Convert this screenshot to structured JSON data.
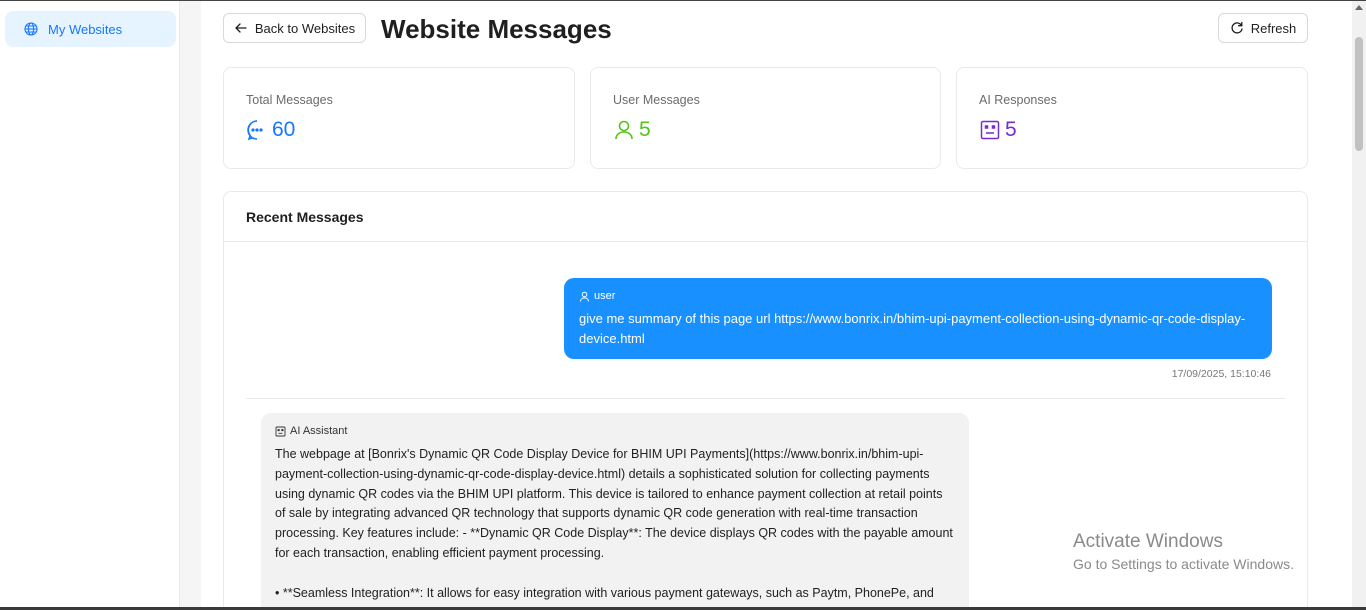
{
  "sidebar": {
    "items": [
      {
        "label": "My Websites",
        "icon": "globe-icon",
        "active": true
      }
    ]
  },
  "header": {
    "back_label": "Back to Websites",
    "title": "Website Messages",
    "refresh_label": "Refresh"
  },
  "stats": [
    {
      "label": "Total Messages",
      "value": "60",
      "icon": "chat-bubble-icon",
      "color": "#1677ff"
    },
    {
      "label": "User Messages",
      "value": "5",
      "icon": "user-icon",
      "color": "#52c41a"
    },
    {
      "label": "AI Responses",
      "value": "5",
      "icon": "robot-icon",
      "color": "#722ed1"
    }
  ],
  "recent": {
    "title": "Recent Messages",
    "messages": [
      {
        "role": "user",
        "text": "give me summary of this page url https://www.bonrix.in/bhim-upi-payment-collection-using-dynamic-qr-code-display-device.html",
        "timestamp": "17/09/2025, 15:10:46"
      },
      {
        "role": "AI Assistant",
        "text": "The webpage at [Bonrix's Dynamic QR Code Display Device for BHIM UPI Payments](https://www.bonrix.in/bhim-upi-payment-collection-using-dynamic-qr-code-display-device.html) details a sophisticated solution for collecting payments using dynamic QR codes via the BHIM UPI platform. This device is tailored to enhance payment collection at retail points of sale by integrating advanced QR technology that supports dynamic QR code generation with real-time transaction processing. Key features include: - **Dynamic QR Code Display**: The device displays QR codes with the payable amount for each transaction, enabling efficient payment processing.",
        "text2": "• **Seamless Integration**: It allows for easy integration with various payment gateways, such as Paytm, PhonePe, and"
      }
    ]
  },
  "watermark": {
    "line1": "Activate Windows",
    "line2": "Go to Settings to activate Windows."
  },
  "colors": {
    "accent": "#1677ff",
    "user_bubble": "#1890ff",
    "ai_bubble": "#f2f2f2",
    "sidebar_active_bg": "#e6f4ff"
  }
}
